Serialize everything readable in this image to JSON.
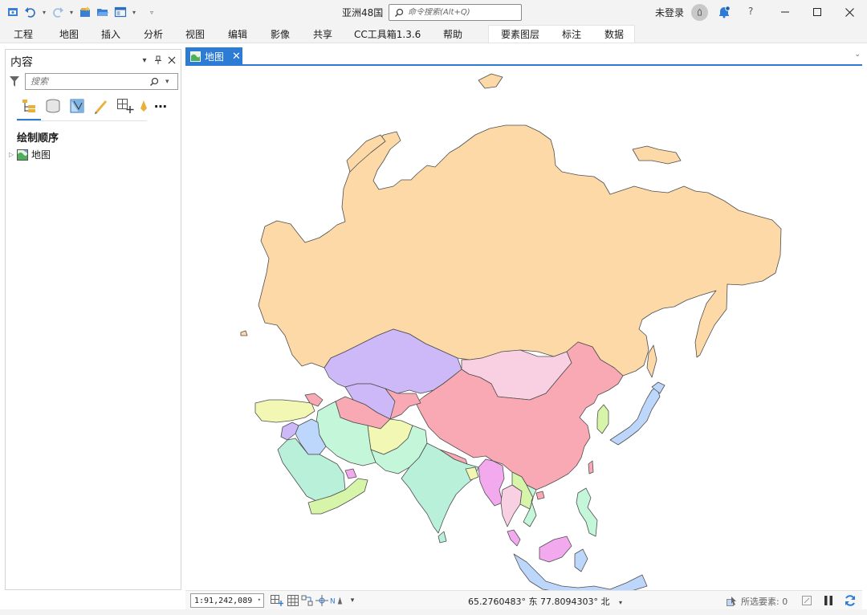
{
  "window": {
    "title": "亚洲48国",
    "command_search_placeholder": "命令搜索(Alt+Q)",
    "user_status": "未登录",
    "help_label": "?"
  },
  "ribbon": {
    "tabs": [
      "工程",
      "地图",
      "插入",
      "分析",
      "视图",
      "编辑",
      "影像",
      "共享",
      "CC工具箱1.3.6",
      "帮助"
    ],
    "contextual_tabs": [
      "要素图层",
      "标注",
      "数据"
    ]
  },
  "contents_pane": {
    "title": "内容",
    "search_placeholder": "搜索",
    "section_title": "绘制顺序",
    "tree_items": [
      {
        "label": "地图"
      }
    ]
  },
  "map_view": {
    "tab_label": "地图",
    "land_color": "#fcd9a7",
    "country_colors": [
      "#fcd9a7",
      "#cdb8f8",
      "#f9a9b4",
      "#f9d0e2",
      "#c4f6da",
      "#b9f0da",
      "#d6f5a8",
      "#f2f8b4",
      "#bcd7fb",
      "#f3a9ee"
    ]
  },
  "statusbar": {
    "scale": "1:91,242,089",
    "coordinates": "65.2760483° 东  77.8094303° 北",
    "selected_label": "所选要素: 0"
  }
}
